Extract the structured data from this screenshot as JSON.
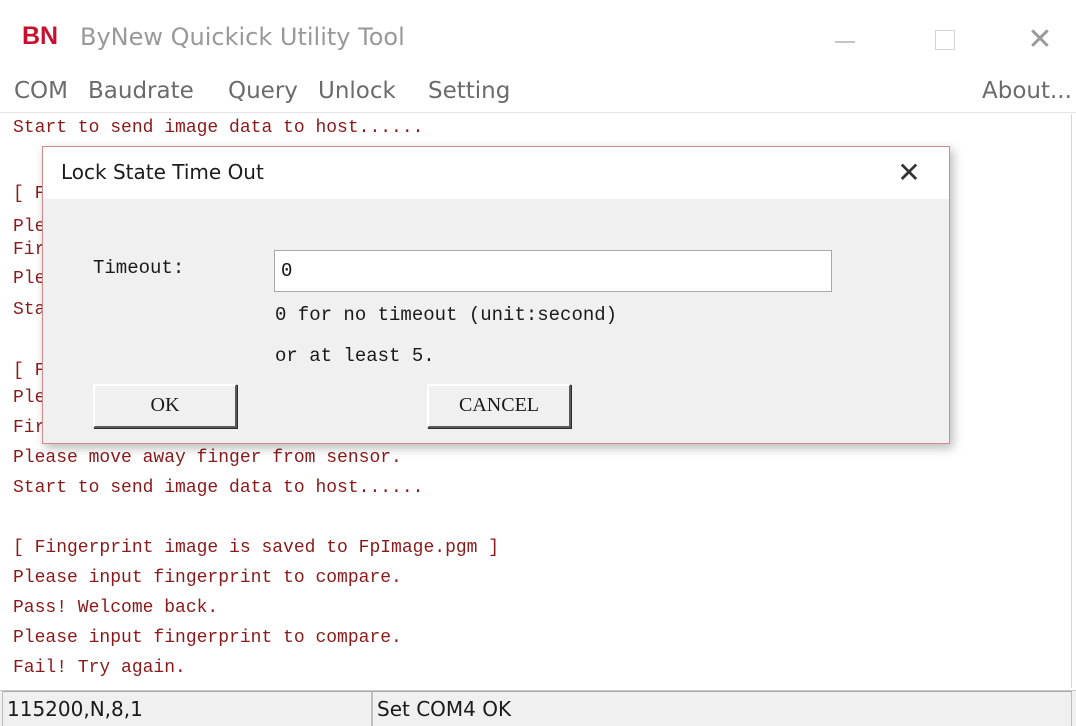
{
  "window": {
    "logo": "BN",
    "title": "ByNew Quickick Utility Tool",
    "close_glyph": "✕"
  },
  "menu": {
    "items": [
      "COM",
      "Baudrate",
      "Query",
      "Unlock",
      "Setting"
    ],
    "about": "About..."
  },
  "log": {
    "lines": [
      "Start to send image data to host......",
      "",
      "[ F",
      "Ple",
      "Fir",
      "Ple",
      "Sta",
      "",
      "[ F",
      "Ple",
      "Fir",
      "Please move away finger from sensor.",
      "Start to send image data to host......",
      "",
      "[ Fingerprint image is saved to FpImage.pgm ]",
      "Please input fingerprint to compare.",
      "Pass! Welcome back.",
      "Please input fingerprint to compare.",
      "Fail! Try again."
    ]
  },
  "dialog": {
    "title": "Lock State Time Out",
    "close_glyph": "✕",
    "timeout_label": "Timeout:",
    "timeout_value": "0",
    "hint_line1": "0 for no timeout (unit:second)",
    "hint_line2": "or at least 5.",
    "ok_label": "OK",
    "cancel_label": "CANCEL"
  },
  "status": {
    "baud": "115200,N,8,1",
    "message": "Set COM4 OK"
  },
  "colors": {
    "logo": "#c8102e",
    "log_text": "#8a1a1a",
    "dialog_border": "#cf8a8a"
  }
}
